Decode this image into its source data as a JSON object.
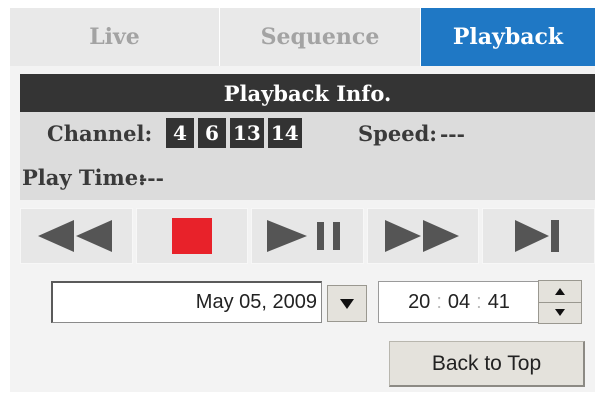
{
  "tabs": [
    {
      "label": "Live"
    },
    {
      "label": "Sequence"
    },
    {
      "label": "Playback",
      "active": true
    }
  ],
  "playback_info": {
    "title": "Playback Info.",
    "channel_label": "Channel:",
    "channels": [
      "4",
      "6",
      "13",
      "14"
    ],
    "speed_label": "Speed:",
    "speed_value": "---",
    "play_time_label": "Play Time:",
    "play_time_value": "---"
  },
  "controls": [
    {
      "icon": "rewind-icon"
    },
    {
      "icon": "stop-icon"
    },
    {
      "icon": "play-pause-icon"
    },
    {
      "icon": "fast-forward-icon"
    },
    {
      "icon": "next-frame-icon"
    }
  ],
  "date_selector": {
    "value": "May 05, 2009"
  },
  "time_selector": {
    "hour": "20",
    "minute": "04",
    "second": "41",
    "separator": ":"
  },
  "back_to_top": {
    "label": "Back to Top"
  },
  "colors": {
    "active_tab": "#1f78c5",
    "header_bg": "#343434",
    "stop_red": "#e8222a",
    "control_gray": "#555555"
  }
}
